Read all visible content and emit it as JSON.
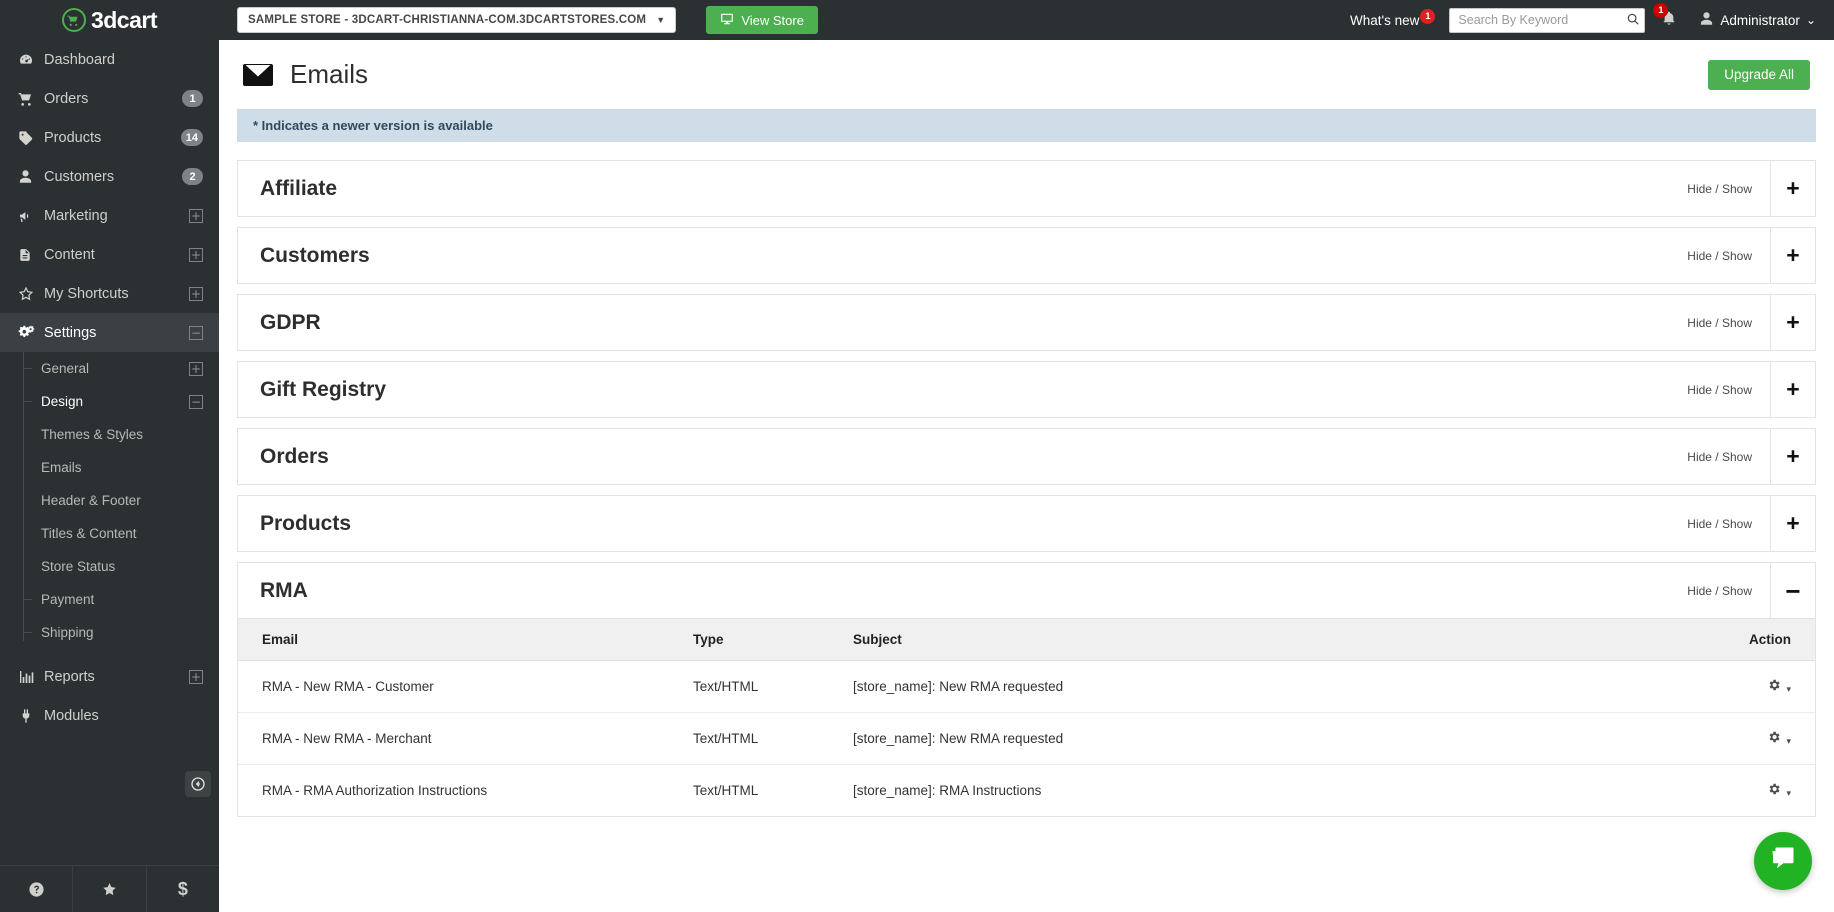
{
  "brand": {
    "name": "3dcart",
    "logo_icon": "cart-circle-icon"
  },
  "sidebar": {
    "items": [
      {
        "label": "Dashboard",
        "icon": "speedometer-icon",
        "badge": null,
        "expander": null,
        "active": false
      },
      {
        "label": "Orders",
        "icon": "cart-icon",
        "badge": "1",
        "expander": null,
        "active": false
      },
      {
        "label": "Products",
        "icon": "tag-icon",
        "badge": "14",
        "expander": null,
        "active": false
      },
      {
        "label": "Customers",
        "icon": "user-icon",
        "badge": "2",
        "expander": null,
        "active": false
      },
      {
        "label": "Marketing",
        "icon": "megaphone-icon",
        "badge": null,
        "expander": "+",
        "active": false
      },
      {
        "label": "Content",
        "icon": "document-icon",
        "badge": null,
        "expander": "+",
        "active": false
      },
      {
        "label": "My Shortcuts",
        "icon": "star-icon",
        "badge": null,
        "expander": "+",
        "active": false
      },
      {
        "label": "Settings",
        "icon": "gears-icon",
        "badge": null,
        "expander": "−",
        "active": true
      }
    ],
    "settings_submenu": [
      {
        "label": "General",
        "expander": "+",
        "selected": false,
        "tick": true
      },
      {
        "label": "Design",
        "expander": "−",
        "selected": true,
        "tick": true
      },
      {
        "label": "Themes & Styles",
        "expander": null,
        "selected": false,
        "tick": false
      },
      {
        "label": "Emails",
        "expander": null,
        "selected": false,
        "tick": false
      },
      {
        "label": "Header & Footer",
        "expander": null,
        "selected": false,
        "tick": false
      },
      {
        "label": "Titles & Content",
        "expander": null,
        "selected": false,
        "tick": false
      },
      {
        "label": "Store Status",
        "expander": null,
        "selected": false,
        "tick": false
      },
      {
        "label": "Payment",
        "expander": null,
        "selected": false,
        "tick": true
      },
      {
        "label": "Shipping",
        "expander": null,
        "selected": false,
        "tick": true
      }
    ],
    "items_after": [
      {
        "label": "Reports",
        "icon": "bar-chart-icon",
        "badge": null,
        "expander": "+",
        "active": false
      },
      {
        "label": "Modules",
        "icon": "plug-icon",
        "badge": null,
        "expander": null,
        "active": false
      }
    ],
    "bottom_buttons": [
      {
        "icon": "help-circle-icon",
        "glyph": "?"
      },
      {
        "icon": "star-icon",
        "glyph": "★"
      },
      {
        "icon": "dollar-icon",
        "glyph": "$"
      }
    ],
    "collapse_button": {
      "icon": "arrow-left-circle-icon",
      "glyph": "◀"
    }
  },
  "topbar": {
    "store_selector": {
      "label": "SAMPLE STORE - 3DCART-CHRISTIANNA-COM.3DCARTSTORES.COM",
      "caret": "▼"
    },
    "view_store": {
      "label": "View Store",
      "icon": "monitor-icon"
    },
    "whats_new": {
      "label": "What's new",
      "badge": "1"
    },
    "search": {
      "placeholder": "Search By Keyword",
      "value": "",
      "icon": "search-icon"
    },
    "notifications": {
      "badge": "1",
      "icon": "bell-icon"
    },
    "account": {
      "label": "Administrator",
      "icon": "user-icon",
      "caret": "⌄"
    }
  },
  "page": {
    "title": "Emails",
    "title_icon": "envelope-icon",
    "upgrade_all_label": "Upgrade All",
    "notice": "* Indicates a newer version is available"
  },
  "sections": [
    {
      "title": "Affiliate",
      "hide_show": "Hide / Show",
      "toggle": "+",
      "expanded": false
    },
    {
      "title": "Customers",
      "hide_show": "Hide / Show",
      "toggle": "+",
      "expanded": false
    },
    {
      "title": "GDPR",
      "hide_show": "Hide / Show",
      "toggle": "+",
      "expanded": false
    },
    {
      "title": "Gift Registry",
      "hide_show": "Hide / Show",
      "toggle": "+",
      "expanded": false
    },
    {
      "title": "Orders",
      "hide_show": "Hide / Show",
      "toggle": "+",
      "expanded": false
    },
    {
      "title": "Products",
      "hide_show": "Hide / Show",
      "toggle": "+",
      "expanded": false
    },
    {
      "title": "RMA",
      "hide_show": "Hide / Show",
      "toggle": "−",
      "expanded": true
    }
  ],
  "rma_table": {
    "columns": [
      "Email",
      "Type",
      "Subject",
      "Action"
    ],
    "rows": [
      {
        "email": "RMA - New RMA - Customer",
        "type": "Text/HTML",
        "subject": "[store_name]: New RMA requested",
        "action_icon": "gear-icon",
        "action_caret": "▾"
      },
      {
        "email": "RMA - New RMA - Merchant",
        "type": "Text/HTML",
        "subject": "[store_name]: New RMA requested",
        "action_icon": "gear-icon",
        "action_caret": "▾"
      },
      {
        "email": "RMA - RMA Authorization Instructions",
        "type": "Text/HTML",
        "subject": "[store_name]: RMA Instructions",
        "action_icon": "gear-icon",
        "action_caret": "▾"
      }
    ]
  },
  "chat_widget": {
    "icon": "chat-bubble-icon",
    "glyph": "▰"
  },
  "colors": {
    "sidebar_bg": "#2b3033",
    "accent_green": "#4caf50",
    "notice_bg": "#cfdde8",
    "badge_red": "#e02020",
    "chat_green": "#22b324"
  }
}
